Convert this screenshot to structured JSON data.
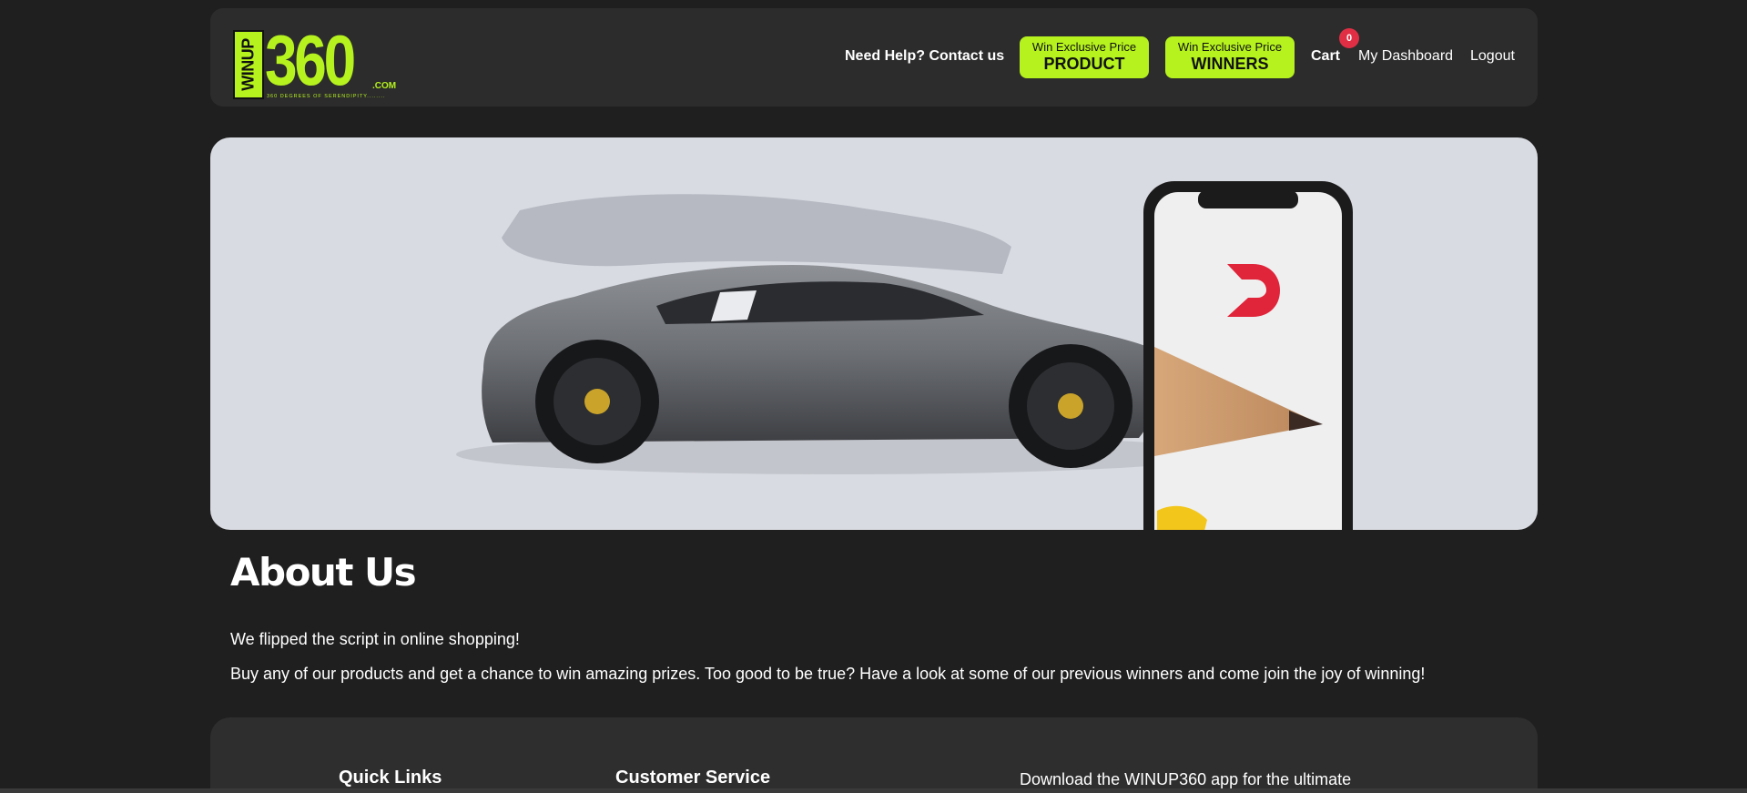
{
  "brand": {
    "side_text": "WINUP",
    "number": "360",
    "dotcom": ".COM",
    "tagline": "360 DEGREES OF SERENDIPITY........"
  },
  "nav": {
    "help": "Need Help? Contact us",
    "product_small": "Win Exclusive Price",
    "product_big": "PRODUCT",
    "winners_small": "Win Exclusive Price",
    "winners_big": "WINNERS",
    "cart": "Cart",
    "cart_count": "0",
    "dashboard": "My Dashboard",
    "logout": "Logout"
  },
  "colors": {
    "accent": "#b5f21e",
    "badge": "#e02f45",
    "background": "#1f1f1f",
    "panel": "#2c2c2c"
  },
  "about": {
    "title": "About Us",
    "line1": "We flipped the script in online shopping!",
    "line2": "Buy any of our products and get a chance to win amazing prizes. Too good to be true? Have a look at some of our previous winners and come join the joy of winning!"
  },
  "footer": {
    "quick_links": "Quick Links",
    "customer_service": "Customer Service",
    "download": "Download the WINUP360 app for the ultimate"
  }
}
